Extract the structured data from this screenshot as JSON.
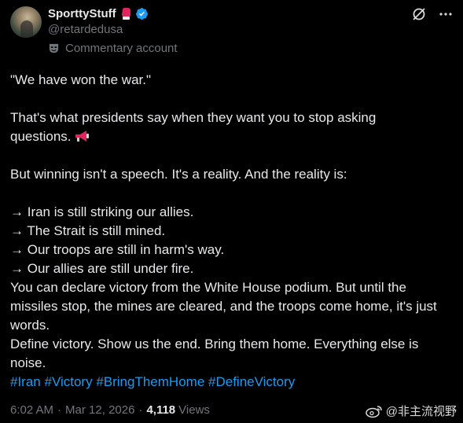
{
  "author": {
    "display_name": "SporttyStuff",
    "handle": "@retardedusa",
    "label": "Commentary account",
    "verified": true
  },
  "post": {
    "line1": "\"We have won the war.\"",
    "line2": "That's what presidents say when they want you to stop asking",
    "line3": "questions.",
    "line4": "But winning isn't a speech. It's a reality. And the reality is:",
    "bullet1": "→ Iran is still striking our allies.",
    "bullet2": "→ The Strait is still mined.",
    "bullet3": "→ Our troops are still in harm's way.",
    "bullet4": "→ Our allies are still under fire.",
    "line5": "You can declare victory from the White House podium. But until the",
    "line6": "missiles stop, the mines are cleared, and the troops come home, it's just",
    "line7": "words.",
    "line8": "Define victory. Show us the end. Bring them home. Everything else is",
    "line9": "noise.",
    "hashtags": [
      "#Iran",
      "#Victory",
      "#BringThemHome",
      "#DefineVictory"
    ]
  },
  "meta": {
    "time": "6:02 AM",
    "separator": "·",
    "date": "Mar 12, 2026",
    "views_count": "4,118",
    "views_label": "Views"
  },
  "watermark": {
    "text": "@非主流视野"
  },
  "colors": {
    "background": "#000000",
    "text": "#e7e9ea",
    "muted": "#71767b",
    "link": "#1d9bf0",
    "verified": "#1d9bf0"
  },
  "icons": [
    "boxing-glove-icon",
    "verified-badge-icon",
    "mask-icon",
    "grok-icon",
    "more-icon",
    "megaphone-icon",
    "weibo-icon"
  ]
}
